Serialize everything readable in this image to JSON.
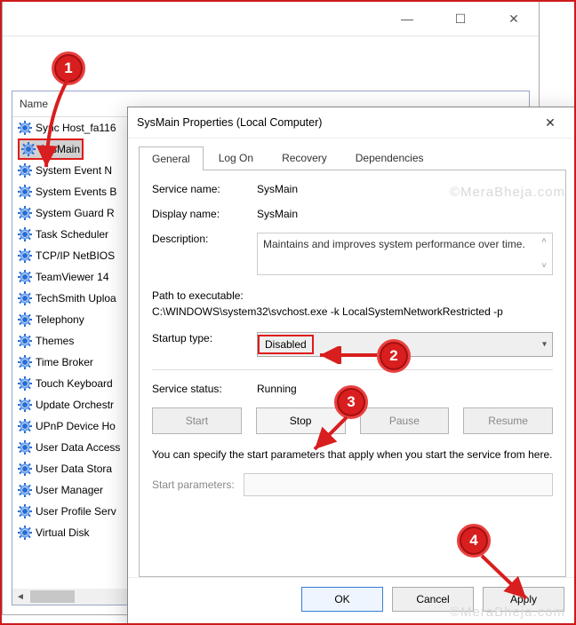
{
  "parent_window": {
    "list_header": "Name",
    "services": [
      "Sync Host_fa116",
      "SysMain",
      "System Event N",
      "System Events B",
      "System Guard R",
      "Task Scheduler",
      "TCP/IP NetBIOS",
      "TeamViewer 14",
      "TechSmith Uploa",
      "Telephony",
      "Themes",
      "Time Broker",
      "Touch Keyboard",
      "Update Orchestr",
      "UPnP Device Ho",
      "User Data Access",
      "User Data Stora",
      "User Manager",
      "User Profile Serv",
      "Virtual Disk"
    ],
    "highlighted_index": 1
  },
  "dialog": {
    "title": "SysMain Properties (Local Computer)",
    "tabs": [
      "General",
      "Log On",
      "Recovery",
      "Dependencies"
    ],
    "active_tab": 0,
    "labels": {
      "service_name": "Service name:",
      "display_name": "Display name:",
      "description": "Description:",
      "path": "Path to executable:",
      "startup": "Startup type:",
      "status": "Service status:",
      "hint": "You can specify the start parameters that apply when you start the service from here.",
      "start_params": "Start parameters:"
    },
    "values": {
      "service_name": "SysMain",
      "display_name": "SysMain",
      "description": "Maintains and improves system performance over time.",
      "path": "C:\\WINDOWS\\system32\\svchost.exe -k LocalSystemNetworkRestricted -p",
      "startup": "Disabled",
      "status": "Running",
      "start_params": ""
    },
    "service_buttons": {
      "start": "Start",
      "stop": "Stop",
      "pause": "Pause",
      "resume": "Resume"
    },
    "footer": {
      "ok": "OK",
      "cancel": "Cancel",
      "apply": "Apply"
    }
  },
  "annotations": {
    "m1": "1",
    "m2": "2",
    "m3": "3",
    "m4": "4"
  },
  "watermark": "©MeraBheja.com"
}
